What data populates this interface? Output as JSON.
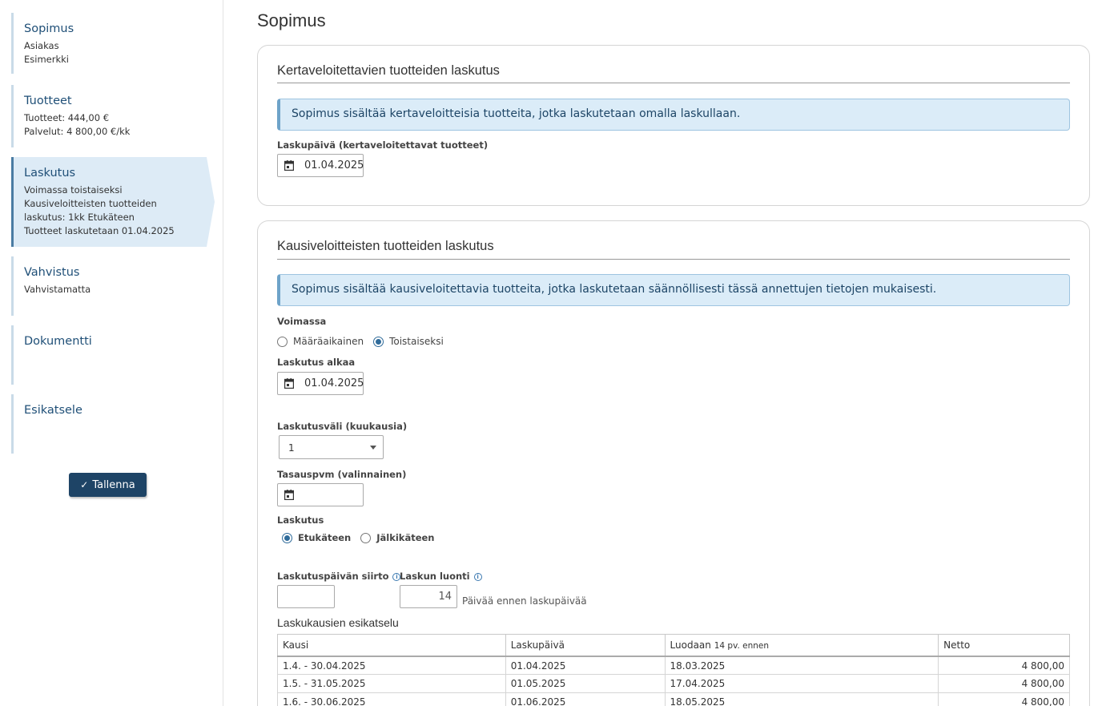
{
  "sidebar": {
    "steps": [
      {
        "title": "Sopimus",
        "lines": [
          "Asiakas",
          "Esimerkki"
        ]
      },
      {
        "title": "Tuotteet",
        "lines": [
          "Tuotteet: 444,00 €",
          "Palvelut: 4 800,00 €/kk"
        ]
      },
      {
        "title": "Laskutus",
        "lines": [
          "Voimassa toistaiseksi",
          "Kausiveloitteisten tuotteiden",
          "laskutus: 1kk Etukäteen",
          "Tuotteet laskutetaan 01.04.2025"
        ]
      },
      {
        "title": "Vahvistus",
        "lines": [
          "Vahvistamatta"
        ]
      },
      {
        "title": "Dokumentti",
        "lines": []
      },
      {
        "title": "Esikatsele",
        "lines": []
      }
    ],
    "save_label": "Tallenna"
  },
  "page": {
    "title": "Sopimus"
  },
  "one_time": {
    "title": "Kertaveloitettavien tuotteiden laskutus",
    "info": "Sopimus sisältää kertaveloitteisia tuotteita, jotka laskutetaan omalla laskullaan.",
    "invoice_date_label": "Laskupäivä (kertaveloitettavat tuotteet)",
    "invoice_date": "01.04.2025"
  },
  "periodic": {
    "title": "Kausiveloitteisten tuotteiden laskutus",
    "info": "Sopimus sisältää kausiveloitettavia tuotteita, jotka laskutetaan säännöllisesti tässä annettujen tietojen mukaisesti.",
    "validity_label": "Voimassa",
    "validity_options": [
      "Määräaikainen",
      "Toistaiseksi"
    ],
    "validity_selected": "Toistaiseksi",
    "start_label": "Laskutus alkaa",
    "start_date": "01.04.2025",
    "interval_label": "Laskutusväli (kuukausia)",
    "interval_value": "1",
    "alignment_label": "Tasauspvm (valinnainen)",
    "alignment_value": "",
    "billing_label": "Laskutus",
    "billing_options": [
      "Etukäteen",
      "Jälkikäteen"
    ],
    "billing_selected": "Etukäteen",
    "shift_label": "Laskutuspäivän siirto",
    "shift_value": "",
    "creation_label": "Laskun luonti",
    "creation_value": "14",
    "creation_hint": "Päivää ennen laskupäivää",
    "preview_title": "Laskukausien esikatselu",
    "table": {
      "headers": [
        "Kausi",
        "Laskupäivä",
        "Luodaan",
        "Netto"
      ],
      "header_note": "14 pv. ennen",
      "rows": [
        [
          "1.4. - 30.04.2025",
          "01.04.2025",
          "18.03.2025",
          "4 800,00"
        ],
        [
          "1.5. - 31.05.2025",
          "01.05.2025",
          "17.04.2025",
          "4 800,00"
        ],
        [
          "1.6. - 30.06.2025",
          "01.06.2025",
          "18.05.2025",
          "4 800,00"
        ]
      ]
    }
  }
}
